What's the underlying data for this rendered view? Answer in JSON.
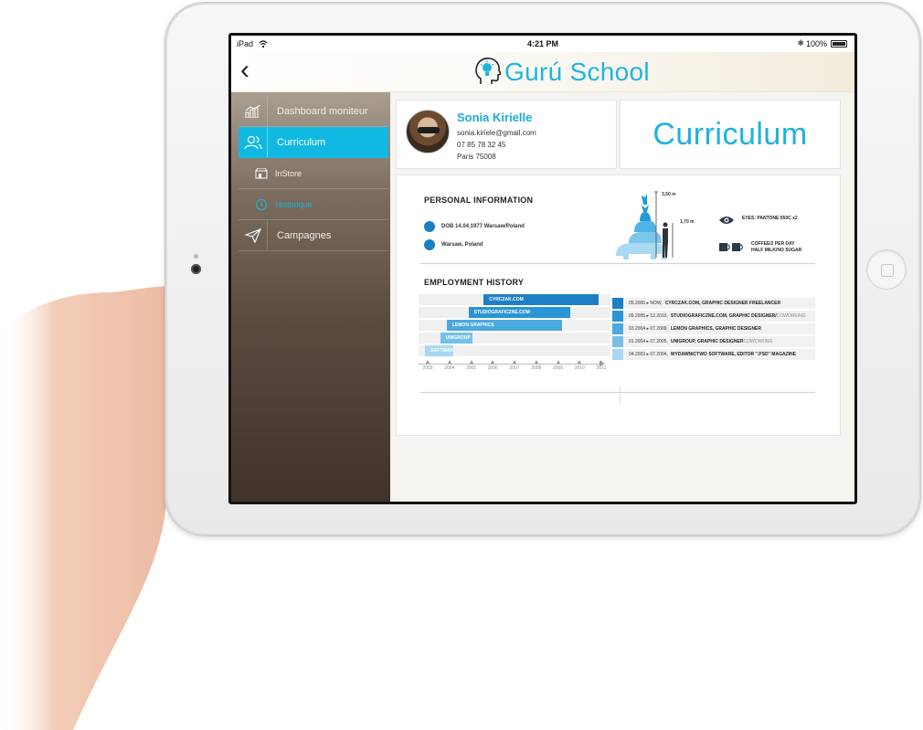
{
  "status_bar": {
    "carrier": "iPad",
    "time": "4:21 PM",
    "battery": "100%"
  },
  "nav": {
    "brand": "Gurú School",
    "brand_color": "#1eb6df"
  },
  "sidebar": {
    "items": [
      {
        "label": "Dashboard moniteur",
        "icon": "chart-icon",
        "active": false
      },
      {
        "label": "Curriculum",
        "icon": "users-icon",
        "active": true
      },
      {
        "label": "InStore",
        "icon": "store-icon",
        "sub": true
      },
      {
        "label": "Historique",
        "icon": "clock-icon",
        "sub": true,
        "current": true
      },
      {
        "label": "Campagnes",
        "icon": "send-icon",
        "active": false
      }
    ],
    "accent": "#11b9e2"
  },
  "profile": {
    "name": "Sonia Kirielle",
    "email": "sonia.kiriele@gmail.com",
    "phone": "07 85 78 32 45",
    "city": "Paris 75008"
  },
  "page_title": "Curriculum",
  "cv": {
    "personal_heading": "PERSONAL INFORMATION",
    "dob": "DOB 14.04.1977 Warsaw/Poland",
    "address": "Warsaw, Poland",
    "height_max": "3,50 m",
    "height_person": "1,70 m",
    "eyes": "EYES: PANTONE 550C x2",
    "coffee_line1": "COFFEE/2 PER DAY",
    "coffee_line2": "HALF MILK/NO SUGAR",
    "employment_heading": "EMPLOYMENT HISTORY",
    "timeline_years": [
      "2003",
      "2004",
      "2005",
      "2006",
      "2007",
      "2008",
      "2009",
      "2010",
      "2011"
    ],
    "bars": [
      {
        "label": "CYRCZAK.COM",
        "start": 2006,
        "end": 2011.3,
        "color": "#1e7fc4"
      },
      {
        "label": "STUDIOGRAFICZNE.COM",
        "start": 2005.3,
        "end": 2010,
        "color": "#2a94d6"
      },
      {
        "label": "LEMON GRAPHICS",
        "start": 2004.3,
        "end": 2009.6,
        "color": "#4aa9df"
      },
      {
        "label": "UNIGROUP",
        "start": 2004,
        "end": 2005.5,
        "color": "#74c0e8"
      },
      {
        "label": "SOFTWARE",
        "start": 2003.3,
        "end": 2004.6,
        "color": "#a7d8f1"
      }
    ],
    "jobs": [
      {
        "period": "05.2006 ▸ NOW,",
        "title": "CYRCZAK.COM, GRAPHIC DESIGNER FREELANCER",
        "extra": "",
        "color": "#1e7fc4"
      },
      {
        "period": "09.2005 ▸ 12.2010,",
        "title": "STUDIOGRAFICZNE.COM, GRAPHIC DESIGNER/",
        "extra": "COWORKING",
        "color": "#2a94d6"
      },
      {
        "period": "03.2004 ▸ 07.2009,",
        "title": "LEMON GRAPHICS, GRAPHIC DESIGNER",
        "extra": "",
        "color": "#4aa9df"
      },
      {
        "period": "01.2004 ▸ 07.2005,",
        "title": "UNIGROUP, GRAPHIC DESIGNER",
        "extra": " COWORKING",
        "color": "#74c0e8"
      },
      {
        "period": "04.2003 ▸ 07.2004,",
        "title": "WYDAWNICTWO SOFTWARE, EDITOR \".PSD\" MAGAZINE",
        "extra": "",
        "color": "#a7d8f1"
      }
    ]
  }
}
